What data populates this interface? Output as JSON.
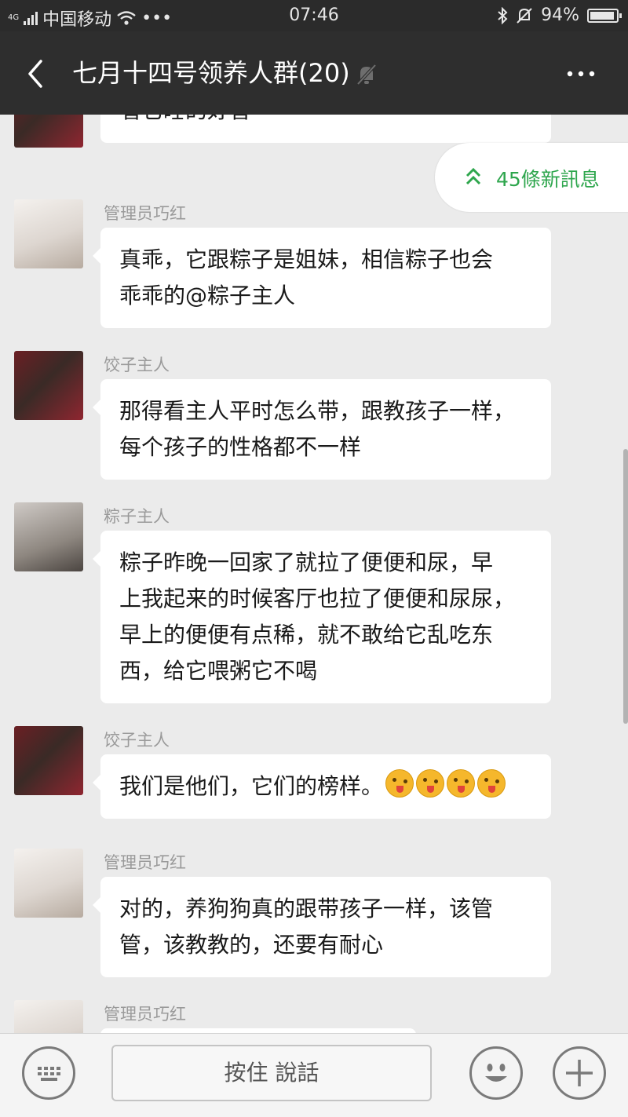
{
  "status_bar": {
    "network": "4G",
    "carrier": "中国移动",
    "dots": "•••",
    "time": "07:46",
    "battery": "94%",
    "battery_level": 0.94
  },
  "header": {
    "title": "七月十四号领养人群(20)",
    "back_icon": "chevron-left-icon",
    "mute_icon": "bell-off-icon",
    "more_icon": "more-dots-icon"
  },
  "new_messages": {
    "label": "45條新訊息",
    "icon": "double-chevron-up-icon",
    "color": "#2ea64d"
  },
  "messages": [
    {
      "sender": "",
      "text": "看它睡的好香",
      "avatar": "male-avatar"
    },
    {
      "sender": "管理员巧红",
      "lines": [
        "真乖，它跟粽子是姐妹，相信粽子也会",
        "乖乖的@粽子主人"
      ],
      "avatar": "female-avatar"
    },
    {
      "sender": "饺子主人",
      "lines": [
        "那得看主人平时怎么带，跟教孩子一样，",
        "每个孩子的性格都不一样"
      ],
      "avatar": "male-avatar"
    },
    {
      "sender": "粽子主人",
      "lines": [
        "粽子昨晚一回家了就拉了便便和尿，早",
        "上我起来的时候客厅也拉了便便和尿尿，",
        "早上的便便有点稀，就不敢给它乱吃东",
        "西，给它喂粥它不喝"
      ],
      "avatar": "girl-avatar"
    },
    {
      "sender": "饺子主人",
      "text": "我们是他们，它们的榜样。",
      "emoji_count": 4,
      "avatar": "male-avatar"
    },
    {
      "sender": "管理员巧红",
      "lines": [
        "对的，养狗狗真的跟带孩子一样，该管",
        "管，该教教的，还要有耐心"
      ],
      "avatar": "female-avatar"
    },
    {
      "sender": "管理员巧红",
      "text": "",
      "avatar": "female-avatar"
    }
  ],
  "input_bar": {
    "hold_to_talk": "按住 說話",
    "keyboard_icon": "keyboard-icon",
    "emoji_icon": "smiley-icon",
    "plus_icon": "plus-icon"
  }
}
